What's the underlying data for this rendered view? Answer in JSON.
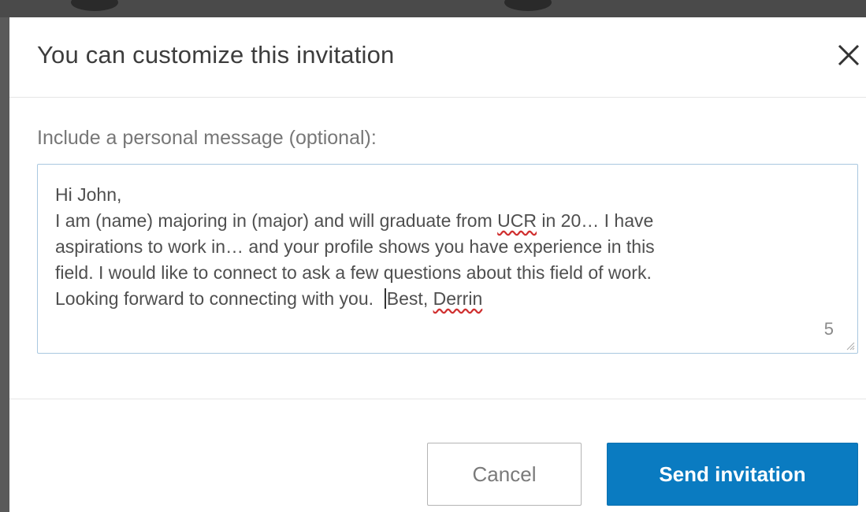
{
  "dialog": {
    "title": "You can customize this invitation",
    "close_icon": "close-icon"
  },
  "body": {
    "label": "Include a personal message (optional):",
    "message": {
      "greeting": "Hi John,",
      "line1_a": "I am (name) majoring in (major) and will graduate from ",
      "line1_spell": "UCR",
      "line1_b": " in 20… I have",
      "line2": "aspirations to work in… and your profile shows you have experience in this",
      "line3": "field. I would like to connect to ask a few questions about this field of work.",
      "line4_a": "Looking forward to connecting with you.  ",
      "line4_b": "Best, ",
      "line4_spell": "Derrin"
    },
    "char_count": "5"
  },
  "footer": {
    "cancel_label": "Cancel",
    "send_label": "Send invitation"
  },
  "colors": {
    "primary": "#0a7bc1",
    "spellcheck": "#d03030"
  }
}
